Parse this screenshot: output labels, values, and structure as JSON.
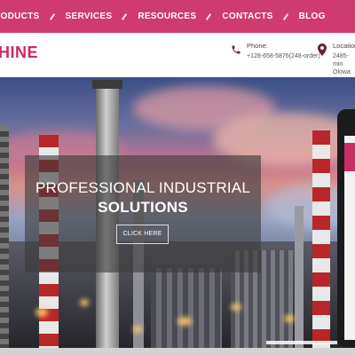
{
  "nav": {
    "items": [
      "PRODUCTS",
      "SERVICES",
      "RESOURCES",
      "CONTACTS",
      "BLOG"
    ]
  },
  "header": {
    "logo": "HINE",
    "phone_label": "Phone:",
    "phone_value": "+128-658-5876(248-order)",
    "location_label": "Location:",
    "location_line1": "2485- min",
    "location_line2": "Olowa DC"
  },
  "hero": {
    "line1": "PROFESSIONAL INDUSTRIAL",
    "line2": "SOLUTIONS",
    "button": "CLICK HERE"
  },
  "colors": {
    "accent": "#cf3a6f",
    "brand": "#c92a63"
  },
  "icons": {
    "phone": "phone-icon",
    "location": "location-pin-icon",
    "nav_separator": "slash-icon"
  }
}
